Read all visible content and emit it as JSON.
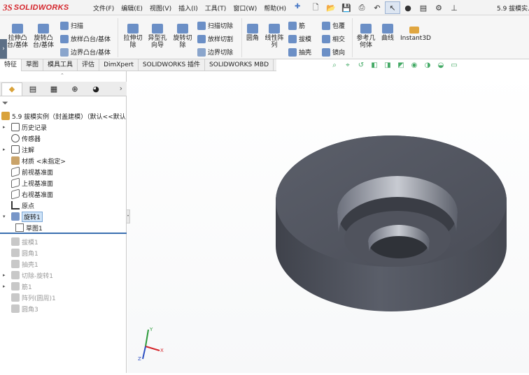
{
  "menubar": {
    "logo_mark": "3S",
    "logo_text": "SOLIDWORKS",
    "items": [
      "文件(F)",
      "编辑(E)",
      "视图(V)",
      "插入(I)",
      "工具(T)",
      "窗口(W)",
      "帮助(H)"
    ],
    "doc_title": "5.9 拔模实..."
  },
  "ribbon": {
    "extrude_boss": "拉伸凸\n台/基体",
    "revolve_boss": "旋转凸\n台/基体",
    "sweep": "扫描",
    "loft_boss": "放样凸台/基体",
    "boundary_boss": "边界凸台/基体",
    "extrude_cut": "拉伸切\n除",
    "hole_wizard": "异型孔\n向导",
    "revolve_cut": "旋转切\n除",
    "sweep_cut": "扫描切除",
    "loft_cut": "放样切割",
    "boundary_cut": "边界切除",
    "fillet": "圆角",
    "linear_pattern": "线性阵\n列",
    "rib": "筋",
    "draft": "拔模",
    "shell": "抽壳",
    "wrap": "包覆",
    "intersect": "相交",
    "mirror": "镜向",
    "ref_geometry": "参考几\n何体",
    "curves": "曲线",
    "instant3d": "Instant3D"
  },
  "tabs": [
    "特征",
    "草图",
    "模具工具",
    "评估",
    "DimXpert",
    "SOLIDWORKS 插件",
    "SOLIDWORKS MBD"
  ],
  "feature_manager": {
    "root": "5.9 拔模实例（封盖建模）（默认<<默认",
    "items": [
      {
        "label": "历史记录",
        "expand": "▸",
        "dim": false
      },
      {
        "label": "传感器",
        "expand": "",
        "dim": false
      },
      {
        "label": "注解",
        "expand": "▸",
        "dim": false
      },
      {
        "label": "材质 <未指定>",
        "expand": "",
        "dim": false
      },
      {
        "label": "前视基准面",
        "expand": "",
        "dim": false
      },
      {
        "label": "上视基准面",
        "expand": "",
        "dim": false
      },
      {
        "label": "右视基准面",
        "expand": "",
        "dim": false
      },
      {
        "label": "原点",
        "expand": "",
        "dim": false
      },
      {
        "label": "旋转1",
        "expand": "▾",
        "dim": false,
        "selected": true
      },
      {
        "label": "草图1",
        "expand": "",
        "dim": false,
        "child": true
      },
      {
        "label": "拔模1",
        "expand": "",
        "dim": true
      },
      {
        "label": "圆角1",
        "expand": "",
        "dim": true
      },
      {
        "label": "抽壳1",
        "expand": "",
        "dim": true
      },
      {
        "label": "切除-旋转1",
        "expand": "▸",
        "dim": true
      },
      {
        "label": "筋1",
        "expand": "▸",
        "dim": true
      },
      {
        "label": "阵列(圆周)1",
        "expand": "",
        "dim": true
      },
      {
        "label": "圆角3",
        "expand": "",
        "dim": true
      }
    ]
  },
  "colors": {
    "part": "#4b4e58",
    "accent": "#d5262c",
    "selection": "#3a6fb0"
  }
}
